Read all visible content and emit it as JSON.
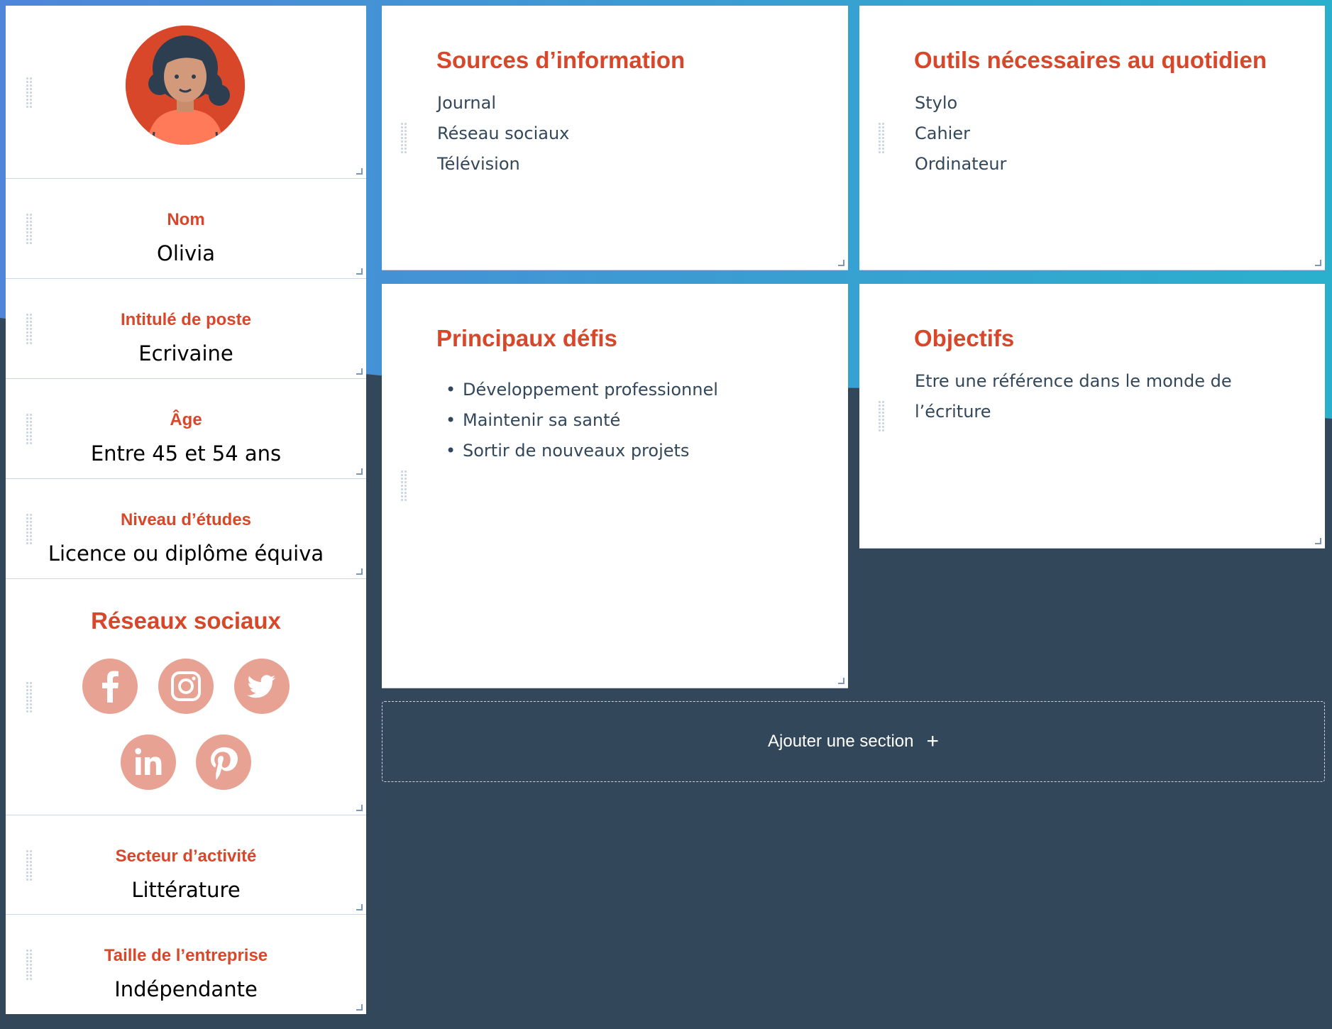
{
  "colors": {
    "accent": "#d9472b",
    "background_dark": "#33475b",
    "gradient_start": "#4f86d9",
    "gradient_end": "#2ab0cc",
    "social_icon_bg": "#e8a293",
    "text_dark": "#33475b"
  },
  "profile": {
    "avatar_icon": "woman-avatar-icon",
    "fields": [
      {
        "label": "Nom",
        "value": "Olivia"
      },
      {
        "label": "Intitulé de poste",
        "value": "Ecrivaine"
      },
      {
        "label": "Âge",
        "value": "Entre 45 et 54 ans"
      },
      {
        "label": "Niveau d’études",
        "value": "Licence ou diplôme équiva"
      }
    ],
    "social": {
      "title": "Réseaux sociaux",
      "icons": [
        "facebook-icon",
        "instagram-icon",
        "twitter-icon",
        "linkedin-icon",
        "pinterest-icon"
      ]
    },
    "fields_after": [
      {
        "label": "Secteur d’activité",
        "value": "Littérature"
      },
      {
        "label": "Taille de l’entreprise",
        "value": "Indépendante"
      }
    ]
  },
  "sections": {
    "sources": {
      "title": "Sources d’information",
      "items": [
        "Journal",
        "Réseau sociaux",
        "Télévision"
      ]
    },
    "outils": {
      "title": "Outils nécessaires au quotidien",
      "items": [
        "Stylo",
        "Cahier",
        "Ordinateur"
      ]
    },
    "defis": {
      "title": "Principaux défis",
      "items": [
        "Développement professionnel",
        "Maintenir sa santé",
        "Sortir de nouveaux projets"
      ]
    },
    "objectifs": {
      "title": "Objectifs",
      "text": "Etre une référence dans le monde de l’écriture"
    }
  },
  "add_section": {
    "label": "Ajouter une section",
    "icon": "plus-icon"
  }
}
